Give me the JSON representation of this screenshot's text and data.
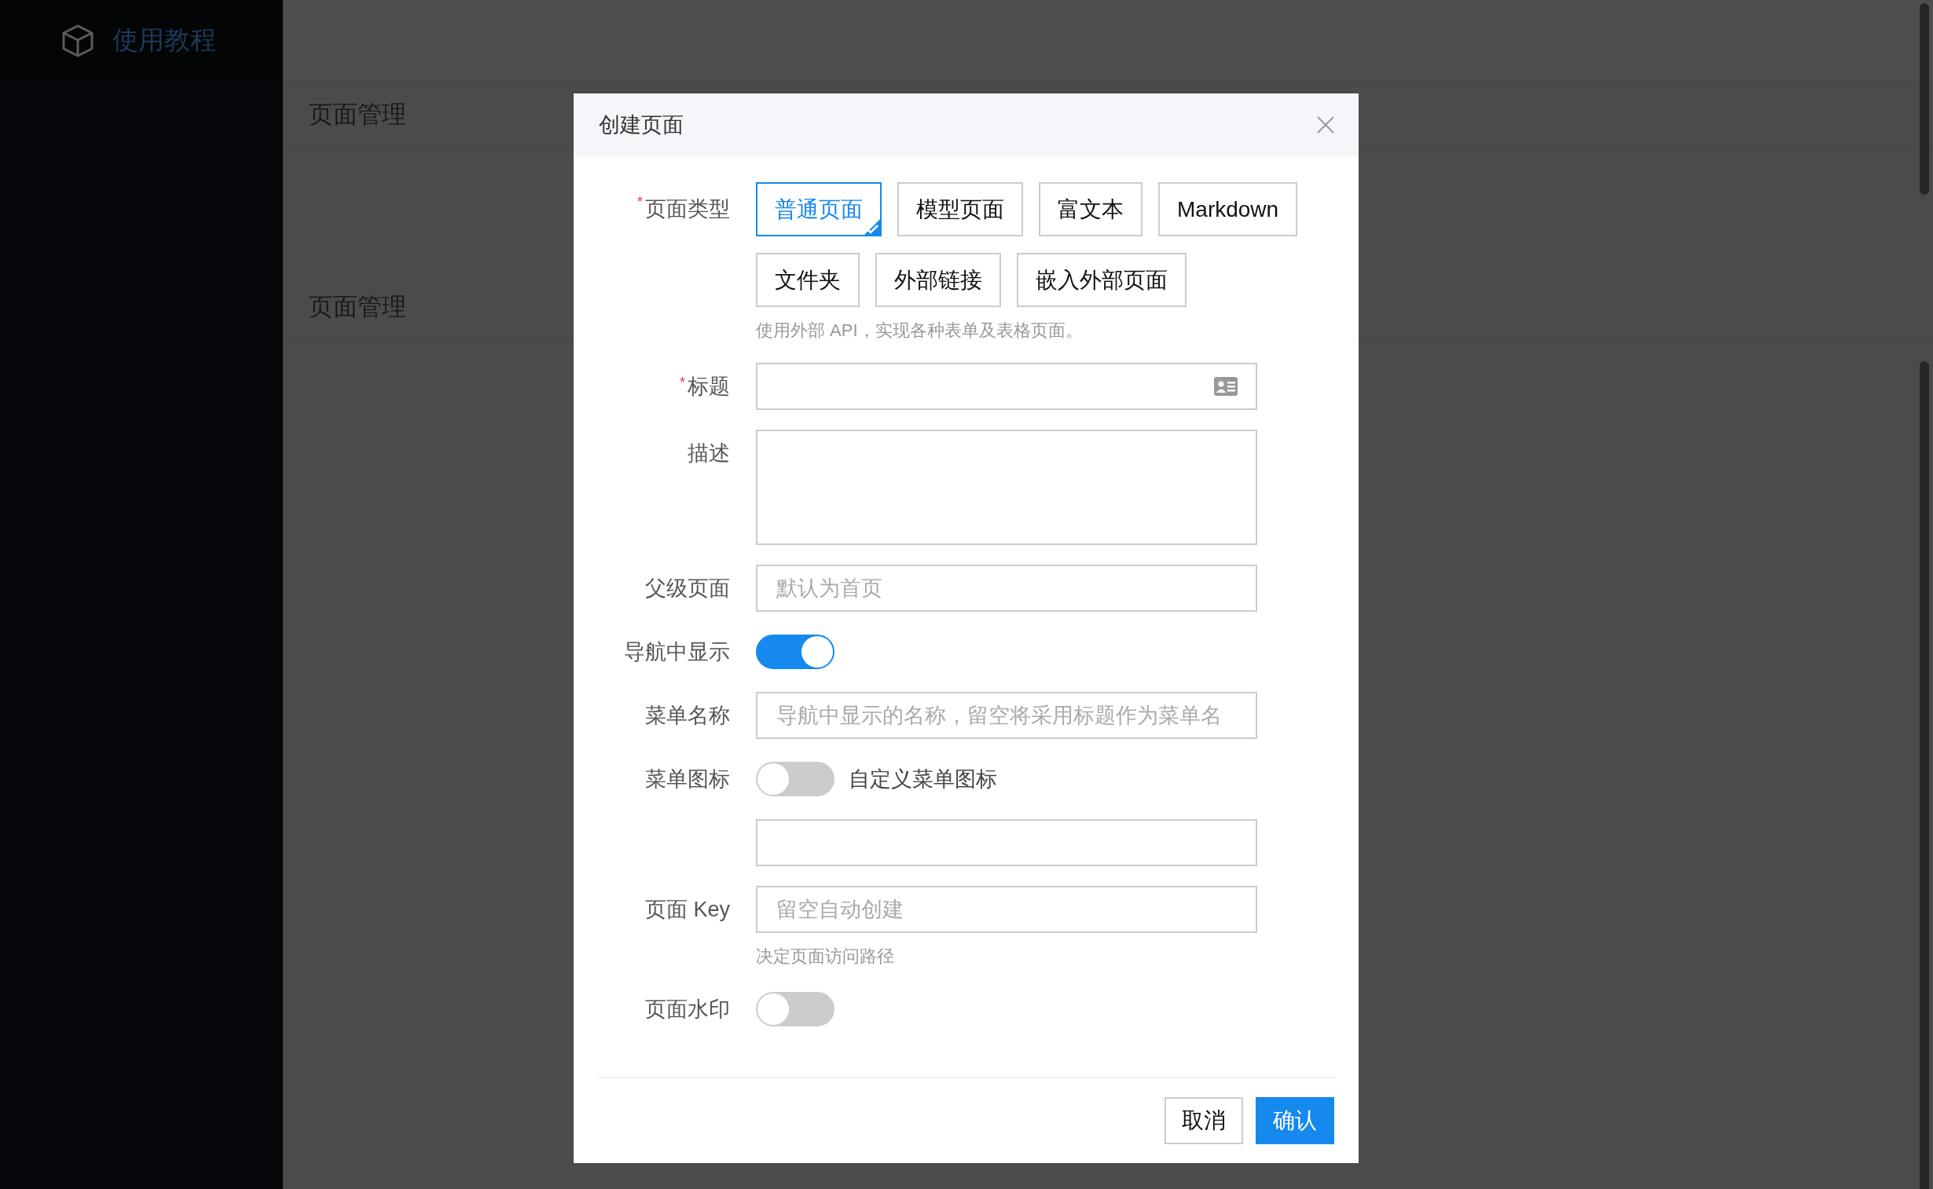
{
  "sidebar": {
    "logo_text": "使用教程"
  },
  "sections": [
    {
      "title": "页面管理"
    },
    {
      "title": "页面管理"
    }
  ],
  "dialog": {
    "title": "创建页面",
    "fields": [
      {
        "kind": "choice",
        "label": "页面类型",
        "required_mark": "*",
        "options": [
          {
            "label": "普通页面",
            "selected": true
          },
          {
            "label": "模型页面",
            "selected": false
          },
          {
            "label": "富文本",
            "selected": false
          },
          {
            "label": "Markdown",
            "selected": false
          },
          {
            "label": "文件夹",
            "selected": false
          },
          {
            "label": "外部链接",
            "selected": false
          },
          {
            "label": "嵌入外部页面",
            "selected": false
          }
        ],
        "help": "使用外部 API，实现各种表单及表格页面。"
      },
      {
        "kind": "input",
        "label": "标题",
        "required_mark": "*",
        "has_icon": true
      },
      {
        "kind": "textarea",
        "label": "描述"
      },
      {
        "kind": "input",
        "label": "父级页面",
        "placeholder": "默认为首页"
      },
      {
        "kind": "switch",
        "label": "导航中显示",
        "on": true
      },
      {
        "kind": "input",
        "label": "菜单名称",
        "placeholder": "导航中显示的名称，留空将采用标题作为菜单名"
      },
      {
        "kind": "switch",
        "label": "菜单图标",
        "on": false,
        "text": "自定义菜单图标"
      },
      {
        "kind": "input"
      },
      {
        "kind": "input",
        "label": "页面 Key",
        "placeholder": "留空自动创建",
        "help": "决定页面访问路径"
      },
      {
        "kind": "switch",
        "label": "页面水印",
        "on": false
      }
    ],
    "buttons": [
      {
        "label": "取消",
        "kind": "default"
      },
      {
        "label": "确认",
        "kind": "primary"
      }
    ]
  }
}
